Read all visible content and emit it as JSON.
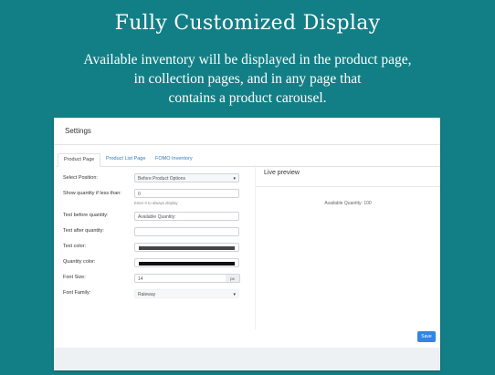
{
  "hero": {
    "title": "Fully Customized Display",
    "subtitle_lines": [
      "Available inventory will be displayed in the product page,",
      "in collection pages, and in any page that",
      "contains a product carousel."
    ]
  },
  "settings": {
    "header": "Settings",
    "tabs": [
      {
        "label": "Product Page",
        "active": true
      },
      {
        "label": "Product List Page",
        "active": false
      },
      {
        "label": "FOMO Inventory",
        "active": false
      }
    ],
    "fields": {
      "select_position": {
        "label": "Select Position:",
        "value": "Before Product Options"
      },
      "show_quantity": {
        "label": "Show quantity if less than:",
        "value": "0",
        "hint": "Enter 0 to always display"
      },
      "text_before": {
        "label": "Text before quantity:",
        "value": "Available Quantity:"
      },
      "text_after": {
        "label": "Text after quantity:",
        "value": ""
      },
      "text_color": {
        "label": "Text color:",
        "color": "#444444"
      },
      "quantity_color": {
        "label": "Quantity color:",
        "color": "#111111"
      },
      "font_size": {
        "label": "Font Size:",
        "value": "14",
        "unit": "px"
      },
      "font_family": {
        "label": "Font Family:",
        "value": "Raleway"
      }
    },
    "preview": {
      "title": "Live preview",
      "text": "Available Quantity: 100"
    },
    "save_label": "Save"
  }
}
